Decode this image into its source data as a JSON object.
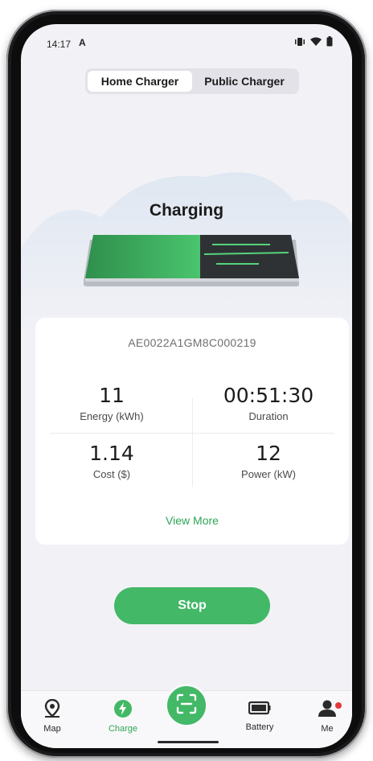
{
  "status_bar": {
    "time": "14:17",
    "app_glyph": "A",
    "icons": [
      "vibrate-icon",
      "wifi-icon",
      "battery-icon"
    ]
  },
  "tabs": [
    {
      "label": "Home Charger",
      "active": true
    },
    {
      "label": "Public Charger",
      "active": false
    }
  ],
  "hero": {
    "title": "Charging"
  },
  "session": {
    "serial": "AE0022A1GM8C000219",
    "metrics": [
      {
        "value": "11",
        "label": "Energy (kWh)"
      },
      {
        "value": "00:51:30",
        "label": "Duration"
      },
      {
        "value": "1.14",
        "label": "Cost ($)"
      },
      {
        "value": "12",
        "label": "Power (kW)"
      }
    ],
    "view_more": "View More"
  },
  "actions": {
    "stop_label": "Stop"
  },
  "nav": {
    "items": [
      {
        "label": "Map",
        "icon": "map-pin-icon"
      },
      {
        "label": "Charge",
        "icon": "lightning-icon",
        "active": true
      },
      {
        "label": "Battery",
        "icon": "battery-icon"
      },
      {
        "label": "Me",
        "icon": "user-icon"
      }
    ],
    "scan_icon": "scan-icon"
  },
  "colors": {
    "accent": "#43b867",
    "accent_text": "#2fa556",
    "badge": "#e5383b"
  }
}
